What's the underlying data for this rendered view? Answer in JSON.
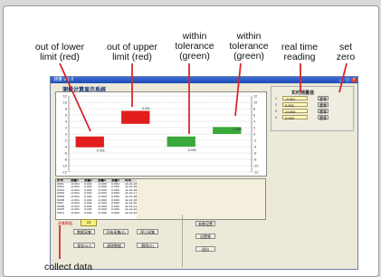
{
  "annotations": {
    "out_of_lower": [
      "out of lower",
      "limit (red)"
    ],
    "out_of_upper": [
      "out of upper",
      "limit (red)"
    ],
    "within_1": [
      "within",
      "tolerance",
      "(green)"
    ],
    "within_2": [
      "within",
      "tolerance",
      "(green)"
    ],
    "real_time": [
      "real time",
      "reading"
    ],
    "set_zero": [
      "set",
      "zero"
    ],
    "collect_data": "collect data"
  },
  "colors": {
    "red": "#e11d1d",
    "green": "#3aa83a",
    "window_bg": "#ece9d8"
  },
  "app": {
    "title_bar": "测量 v 1.0",
    "title": "测量计算显示系统",
    "win_buttons": [
      "_",
      "□",
      "×"
    ]
  },
  "chart_data": {
    "type": "bar",
    "categories": [
      "1",
      "2",
      "3",
      "4"
    ],
    "ranges": [
      [
        -4.2,
        -0.8
      ],
      [
        3.2,
        7.3
      ],
      [
        -4.0,
        -0.8
      ],
      [
        0.0,
        2.2
      ]
    ],
    "status": [
      "out-low",
      "out-high",
      "within",
      "within"
    ],
    "value_labels": [
      "-0.001",
      "0.001",
      "-0.000",
      "0.000"
    ],
    "ylim": [
      -12,
      12
    ],
    "yticks": [
      "12",
      "10",
      "8",
      "6",
      "4",
      "2",
      "0",
      "-2",
      "-4",
      "-6",
      "-8",
      "-10",
      "-12"
    ]
  },
  "readings": {
    "title": "实时测量值",
    "rows": [
      {
        "num": "1",
        "value": "-0.001",
        "zero": "置零"
      },
      {
        "num": "2",
        "value": "0.001",
        "zero": "置零"
      },
      {
        "num": "3",
        "value": "-0.000",
        "zero": "置零"
      },
      {
        "num": "4",
        "value": "0.000",
        "zero": "置零"
      }
    ]
  },
  "table": {
    "headers": [
      "序号",
      "测量1",
      "测量2",
      "测量3",
      "测量4",
      "时间"
    ],
    "rows": [
      [
        "0001",
        "-0.001",
        "0.001",
        "-0.000",
        "0.000",
        "11:21:14"
      ],
      [
        "0002",
        "-0.001",
        "0.001",
        "-0.000",
        "0.000",
        "11:21:15"
      ],
      [
        "0003",
        "-0.001",
        "0.001",
        "-0.000",
        "0.000",
        "11:21:16"
      ],
      [
        "0004",
        "-0.001",
        "0.001",
        "-0.000",
        "0.000",
        "11:21:17"
      ],
      [
        "0005",
        "-0.001",
        "0.001",
        "-0.000",
        "0.000",
        "11:21:18"
      ],
      [
        "0006",
        "-0.001",
        "0.001",
        "-0.000",
        "0.000",
        "11:21:19"
      ],
      [
        "0007",
        "-0.001",
        "0.001",
        "-0.000",
        "0.000",
        "11:21:20"
      ],
      [
        "0008",
        "-0.001",
        "0.001",
        "-0.000",
        "0.000",
        "11:21:21"
      ],
      [
        "0009",
        "-0.001",
        "0.001",
        "-0.000",
        "0.000",
        "11:21:22"
      ],
      [
        "0010",
        "-0.001",
        "0.001",
        "-0.000",
        "0.000",
        "11:21:23"
      ]
    ]
  },
  "status": {
    "label": "采集数据",
    "value": "23"
  },
  "buttons": {
    "b1": "数据采集",
    "b2": "开始采集(S)",
    "b3": "停止采集",
    "b4": "保存XLS",
    "b5": "清除数据",
    "b6": "删除(D)",
    "b7": "参数设置",
    "b8": "设置零",
    "b9": "退出"
  }
}
